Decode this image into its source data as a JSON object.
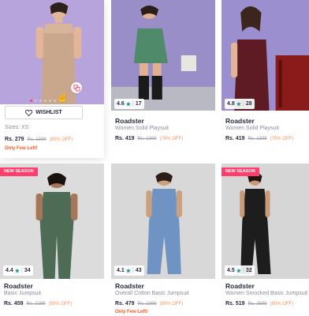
{
  "products": [
    {
      "wishlist_label": "WISHLIST",
      "sizes": "Sizes: XS",
      "price": "Rs. 279",
      "mrp": "Rs. 1399",
      "discount": "(80% OFF)",
      "note": "Only Few Left!",
      "image_bg": "#b8a4dc",
      "dress_color": "#c9a78c"
    },
    {
      "brand": "Roadster",
      "description": "Women Solid Playsuit",
      "rating": "4.6",
      "rating_count": "17",
      "price": "Rs. 419",
      "mrp": "Rs. 1399",
      "discount": "(70% OFF)",
      "image_bg": "#9a8ec8",
      "dress_color": "#4f8a6a"
    },
    {
      "brand": "Roadster",
      "description": "Women Solid Playsuit",
      "rating": "4.8",
      "rating_count": "28",
      "price": "Rs. 419",
      "mrp": "Rs. 1399",
      "discount": "(70% OFF)",
      "image_bg": "#9c8fd0",
      "dress_color": "#5e1b24"
    },
    {
      "badge": "NEW SEASON",
      "brand": "Roadster",
      "description": "Basic Jumpsuit",
      "rating": "4.4",
      "rating_count": "34",
      "price": "Rs. 459",
      "mrp": "Rs. 2299",
      "discount": "(80% OFF)",
      "image_bg": "#dcdcdc",
      "dress_color": "#4e6b55"
    },
    {
      "brand": "Roadster",
      "description": "Overall Cotton Basic Jumpsuit",
      "rating": "4.1",
      "rating_count": "43",
      "price": "Rs. 479",
      "mrp": "Rs. 2399",
      "discount": "(80% OFF)",
      "note": "Only Few Left!",
      "image_bg": "#d8d8d8",
      "dress_color": "#6f94c4"
    },
    {
      "badge": "NEW SEASON",
      "brand": "Roadster",
      "description": "Women Smocked Basic Jumpsuit",
      "rating": "4.5",
      "rating_count": "32",
      "price": "Rs. 519",
      "mrp": "Rs. 2599",
      "discount": "(80% OFF)",
      "image_bg": "#d6d6d6",
      "dress_color": "#1d1d1d"
    }
  ],
  "colors": {
    "accent": "#ff3e6c",
    "discount": "#ff905a",
    "rating_star": "#14958f",
    "few_left": "#ff5722"
  }
}
